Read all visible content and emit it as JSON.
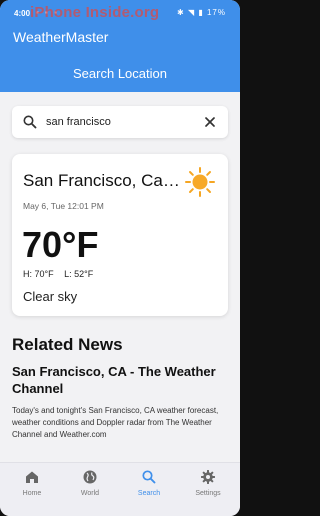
{
  "statusbar": {
    "left_text": "4:00",
    "right_text": "17%"
  },
  "watermark": "iPhone Inside.org",
  "app": {
    "title": "WeatherMaster",
    "page_title": "Search Location",
    "accent_color": "#3f8fea"
  },
  "search": {
    "value": "san francisco",
    "search_icon": "search-icon",
    "clear_icon": "close-icon"
  },
  "weather_card": {
    "city": "San Francisco, California",
    "datetime": "May 6, Tue 12:01 PM",
    "temperature": "70°F",
    "high": "H: 70°F",
    "low": "L: 52°F",
    "condition": "Clear sky",
    "icon": "sun-icon"
  },
  "news": {
    "heading": "Related News",
    "items": [
      {
        "title": "San Francisco, CA - The Weather Channel",
        "description": "Today's and tonight's San Francisco, CA weather forecast, weather conditions and Doppler radar from The Weather Channel and Weather.com"
      }
    ]
  },
  "bottom_nav": {
    "items": [
      {
        "label": "Home",
        "icon": "home-icon",
        "active": false
      },
      {
        "label": "World",
        "icon": "globe-icon",
        "active": false
      },
      {
        "label": "Search",
        "icon": "search-icon",
        "active": true
      },
      {
        "label": "Settings",
        "icon": "gear-icon",
        "active": false
      }
    ]
  }
}
